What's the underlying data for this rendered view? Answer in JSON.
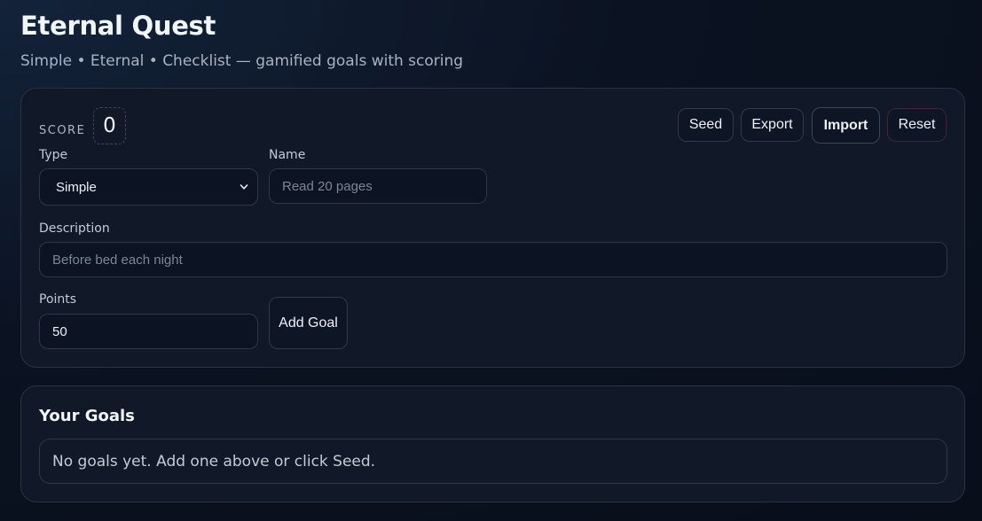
{
  "header": {
    "title": "Eternal Quest",
    "subtitle": "Simple • Eternal • Checklist — gamified goals with scoring"
  },
  "score": {
    "label": "SCORE",
    "value": "0"
  },
  "toolbar": {
    "seed_label": "Seed",
    "export_label": "Export",
    "import_label": "Import",
    "reset_label": "Reset"
  },
  "form": {
    "type_label": "Type",
    "type_value": "Simple",
    "type_options": [
      "Simple"
    ],
    "name_label": "Name",
    "name_placeholder": "Read 20 pages",
    "description_label": "Description",
    "description_placeholder": "Before bed each night",
    "points_label": "Points",
    "points_value": "50",
    "add_label": "Add Goal"
  },
  "goals": {
    "title": "Your Goals",
    "empty_message": "No goals yet. Add one above or click Seed."
  },
  "colors": {
    "background": "#0b1322",
    "card": "#111827",
    "border": "#283345",
    "text": "#e6ebf2",
    "muted": "#a8b3c3"
  },
  "icons": {
    "select_arrow": "chevron-down-icon"
  }
}
